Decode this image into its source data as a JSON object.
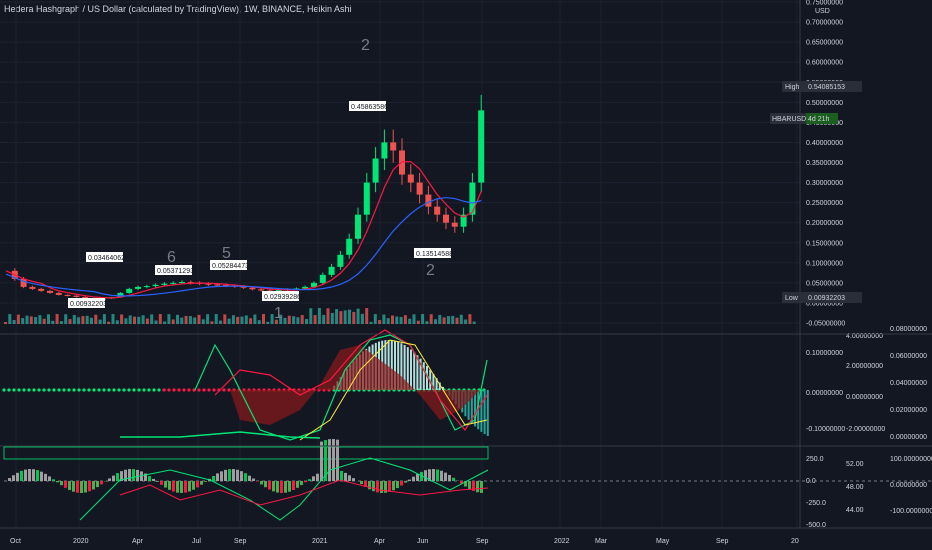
{
  "header": {
    "title": "Hedera Hashgraph / US Dollar (calculated by TradingView), 1W, BINANCE, Heikin Ashi"
  },
  "colors": {
    "background": "#131722",
    "up": "#26a69a",
    "bright_up": "#00e676",
    "down": "#ef5350",
    "grid": "#1e2230",
    "axis_text": "#d1d4dc"
  },
  "labels": {
    "price_high_label": "High",
    "price_high_value": "0.54085153",
    "price_low_label": "Low",
    "price_low_value": "0.00932203",
    "symbol_label": "HBARUSD",
    "symbol_change": "4d 21h",
    "currency": "USD"
  },
  "chart_data": [
    {
      "type": "line",
      "name_hint": "price_panel",
      "yaxis_ticks": [
        "0.75000000",
        "0.70000000",
        "0.65000000",
        "0.60000000",
        "0.55000000",
        "0.50000000",
        "0.45000000",
        "0.40000000",
        "0.35000000",
        "0.30000000",
        "0.25000000",
        "0.20000000",
        "0.15000000",
        "0.10000000",
        "0.05000000",
        "0.00000000",
        "-0.05000000"
      ],
      "ylim": [
        -0.05,
        0.75
      ],
      "xaxis_ticks": [
        "Oct",
        "2020",
        "Apr",
        "Jul",
        "Sep",
        "2021",
        "Apr",
        "Jun",
        "Sep",
        "2022",
        "Mar",
        "May",
        "Sep",
        "20"
      ],
      "price_annotations": [
        "0.00932203",
        "0.03464062",
        "0.05371293",
        "0.05284473",
        "0.02939286",
        "0.45863586",
        "0.13514588"
      ],
      "wave_counts": [
        "6",
        "5",
        "2",
        "1",
        "2"
      ],
      "close_series_x": [
        0,
        2,
        4,
        6,
        8,
        10,
        12,
        14,
        16,
        18,
        20,
        22,
        24,
        26,
        28,
        30,
        32,
        34,
        36,
        38,
        40,
        42,
        44,
        46,
        48,
        50,
        52,
        54,
        56,
        58,
        60,
        62,
        64,
        66,
        68,
        70,
        72,
        74,
        76,
        78,
        80,
        82,
        84,
        86,
        88,
        90,
        92,
        94,
        96,
        98,
        100,
        102,
        104,
        106,
        108
      ],
      "close_series": [
        0.08,
        0.06,
        0.04,
        0.035,
        0.03,
        0.025,
        0.02,
        0.018,
        0.015,
        0.012,
        0.01,
        0.011,
        0.014,
        0.025,
        0.035,
        0.04,
        0.042,
        0.045,
        0.048,
        0.05,
        0.052,
        0.05,
        0.048,
        0.046,
        0.045,
        0.043,
        0.041,
        0.038,
        0.034,
        0.031,
        0.03,
        0.032,
        0.034,
        0.036,
        0.04,
        0.05,
        0.07,
        0.09,
        0.12,
        0.16,
        0.22,
        0.3,
        0.36,
        0.4,
        0.38,
        0.32,
        0.3,
        0.27,
        0.24,
        0.22,
        0.2,
        0.19,
        0.22,
        0.3,
        0.48
      ]
    },
    {
      "type": "line",
      "name_hint": "oscillator_1",
      "yaxis_ticks_left": [
        "0.10000000",
        "0.00000000",
        "-0.10000000"
      ],
      "yaxis_ticks_right": [
        "4.00000000",
        "2.00000000",
        "0.00000000",
        "-2.00000000"
      ],
      "yaxis_ticks_far_right": [
        "0.08000000",
        "0.06000000",
        "0.04000000",
        "0.02000000",
        "0.00000000"
      ]
    },
    {
      "type": "bar",
      "name_hint": "oscillator_2",
      "yaxis_ticks_left": [
        "250.0",
        "0.0",
        "-250.0",
        "-500.0"
      ],
      "yaxis_ticks_mid": [
        "52.00",
        "48.00",
        "44.00"
      ],
      "yaxis_ticks_right": [
        "100.00000000",
        "0.00000000",
        "-100.00000000"
      ]
    }
  ]
}
